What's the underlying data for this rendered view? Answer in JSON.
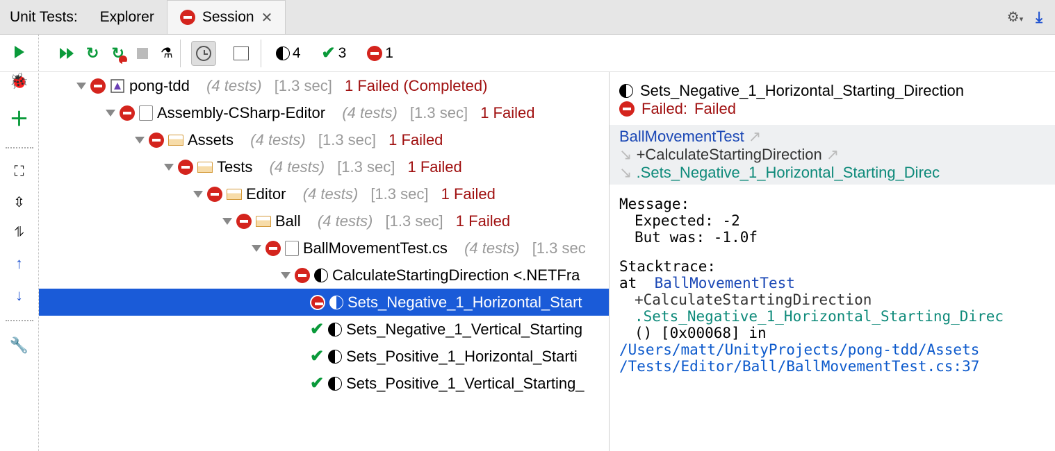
{
  "tabs": {
    "title": "Unit Tests:",
    "explorer": "Explorer",
    "session": "Session"
  },
  "toolbar": {
    "counts": {
      "half": "4",
      "pass": "3",
      "fail": "1"
    }
  },
  "tree": {
    "root": {
      "name": "pong-tdd",
      "meta": "(4 tests)",
      "time": "[1.3 sec]",
      "status": "1 Failed (Completed)"
    },
    "assembly": {
      "name": "Assembly-CSharp-Editor",
      "meta": "(4 tests)",
      "time": "[1.3 sec]",
      "status": "1 Failed"
    },
    "assets": {
      "name": "Assets",
      "meta": "(4 tests)",
      "time": "[1.3 sec]",
      "status": "1 Failed"
    },
    "tests": {
      "name": "Tests",
      "meta": "(4 tests)",
      "time": "[1.3 sec]",
      "status": "1 Failed"
    },
    "editor": {
      "name": "Editor",
      "meta": "(4 tests)",
      "time": "[1.3 sec]",
      "status": "1 Failed"
    },
    "ball": {
      "name": "Ball",
      "meta": "(4 tests)",
      "time": "[1.3 sec]",
      "status": "1 Failed"
    },
    "file": {
      "name": "BallMovementTest.cs",
      "meta": "(4 tests)",
      "time": "[1.3 sec"
    },
    "fixture": {
      "name": "CalculateStartingDirection <.NETFra"
    },
    "t1": {
      "name": "Sets_Negative_1_Horizontal_Start"
    },
    "t2": {
      "name": "Sets_Negative_1_Vertical_Starting"
    },
    "t3": {
      "name": "Sets_Positive_1_Horizontal_Starti"
    },
    "t4": {
      "name": "Sets_Positive_1_Vertical_Starting_"
    }
  },
  "details": {
    "title": "Sets_Negative_1_Horizontal_Starting_Direction",
    "failLabel": "Failed:",
    "failValue": "Failed",
    "trace": {
      "cls": "BallMovementTest",
      "mth": "+CalculateStartingDirection",
      "tst": ".Sets_Negative_1_Horizontal_Starting_Direc"
    },
    "msg": {
      "label": "Message:",
      "l1": "Expected: -2",
      "l2": "But was:  -1.0f"
    },
    "stack": {
      "label": "Stacktrace:",
      "at": "at",
      "cls": "BallMovementTest",
      "mth": "+CalculateStartingDirection",
      "tst": ".Sets_Negative_1_Horizontal_Starting_Direc",
      "brace": "() [0x00068] in",
      "path1": "/Users/matt/UnityProjects/pong-tdd/Assets",
      "path2": "/Tests/Editor/Ball/BallMovementTest.cs:37"
    }
  }
}
